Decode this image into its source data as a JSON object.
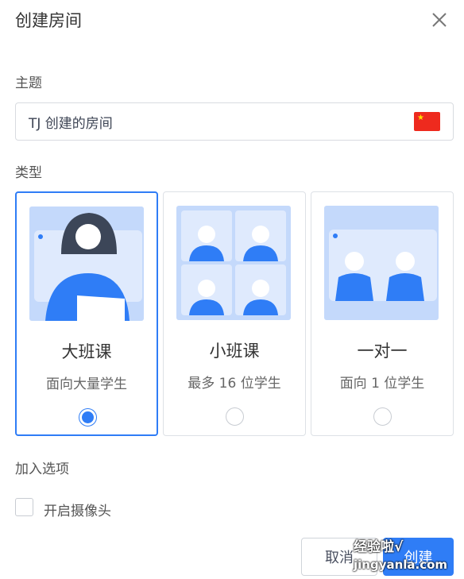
{
  "dialog": {
    "title": "创建房间",
    "close_icon": "close-icon"
  },
  "topic": {
    "label": "主题",
    "value": "TJ 创建的房间",
    "flag_icon": "china-flag-icon"
  },
  "type": {
    "label": "类型",
    "options": [
      {
        "title": "大班课",
        "desc": "面向大量学生",
        "selected": true
      },
      {
        "title": "小班课",
        "desc": "最多 16 位学生",
        "selected": false
      },
      {
        "title": "一对一",
        "desc": "面向 1 位学生",
        "selected": false
      }
    ]
  },
  "join": {
    "label": "加入选项",
    "camera_label": "开启摄像头",
    "camera_checked": false
  },
  "buttons": {
    "cancel": "取消",
    "create": "创建"
  },
  "watermark": {
    "line1": "经验啦√",
    "line2": "jingyanla.com"
  },
  "colors": {
    "accent": "#2f7df6",
    "illustration_bg": "#c4d9fb"
  }
}
